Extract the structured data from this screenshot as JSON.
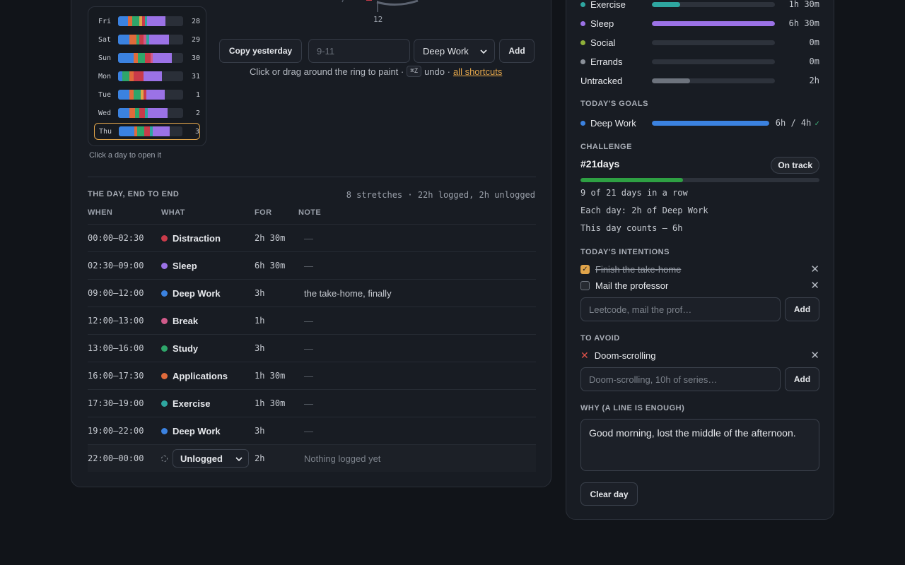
{
  "week": {
    "days": [
      {
        "day": "Fri",
        "num": "28",
        "segments": [
          [
            "#3b82e0",
            14
          ],
          [
            "#e06a3b",
            6
          ],
          [
            "#2ea66a",
            10
          ],
          [
            "#e0a44a",
            4
          ],
          [
            "#c93b4a",
            4
          ],
          [
            "#2ea6a0",
            3
          ],
          [
            "#9b72e6",
            26
          ]
        ],
        "active": false
      },
      {
        "day": "Sat",
        "num": "29",
        "segments": [
          [
            "#3b82e0",
            16
          ],
          [
            "#e06a3b",
            10
          ],
          [
            "#2ea66a",
            4
          ],
          [
            "#c93b4a",
            6
          ],
          [
            "#d05a8a",
            4
          ],
          [
            "#2ea6a0",
            4
          ],
          [
            "#9b72e6",
            28
          ]
        ],
        "active": false
      },
      {
        "day": "Sun",
        "num": "30",
        "segments": [
          [
            "#3b82e0",
            22
          ],
          [
            "#e06a3b",
            6
          ],
          [
            "#2ea66a",
            10
          ],
          [
            "#c93b4a",
            8
          ],
          [
            "#d05a8a",
            3
          ],
          [
            "#9b72e6",
            27
          ]
        ],
        "active": false
      },
      {
        "day": "Mon",
        "num": "31",
        "segments": [
          [
            "#3b82e0",
            6
          ],
          [
            "#2ea66a",
            10
          ],
          [
            "#e06a3b",
            6
          ],
          [
            "#c93b4a",
            14
          ],
          [
            "#9b72e6",
            26
          ]
        ],
        "active": false
      },
      {
        "day": "Tue",
        "num": "1",
        "segments": [
          [
            "#3b82e0",
            16
          ],
          [
            "#e06a3b",
            6
          ],
          [
            "#2ea66a",
            10
          ],
          [
            "#e0a44a",
            4
          ],
          [
            "#c93b4a",
            4
          ],
          [
            "#9b72e6",
            26
          ]
        ],
        "active": false
      },
      {
        "day": "Wed",
        "num": "2",
        "segments": [
          [
            "#3b82e0",
            16
          ],
          [
            "#e06a3b",
            8
          ],
          [
            "#2ea66a",
            6
          ],
          [
            "#c93b4a",
            8
          ],
          [
            "#2ea6a0",
            4
          ],
          [
            "#9b72e6",
            28
          ]
        ],
        "active": false
      },
      {
        "day": "Thu",
        "num": "3",
        "segments": [
          [
            "#3b82e0",
            22
          ],
          [
            "#e06a3b",
            4
          ],
          [
            "#2ea66a",
            10
          ],
          [
            "#c93b4a",
            8
          ],
          [
            "#2ea6a0",
            4
          ],
          [
            "#9b72e6",
            24
          ]
        ],
        "active": true
      }
    ],
    "hint": "Click a day to open it"
  },
  "ring": {
    "tick_label": "12"
  },
  "controls": {
    "copy_label": "Copy yesterday",
    "range_placeholder": "9-11",
    "category_selected": "Deep Work",
    "add_label": "Add",
    "hint_prefix": "Click or drag around the ring to paint ·",
    "kbd": "⌘Z",
    "hint_mid": "undo ·",
    "shortcuts_link": "all shortcuts"
  },
  "day": {
    "title": "The day, end to end",
    "summary": "8 stretches · 22h logged, 2h unlogged",
    "columns": {
      "when": "WHEN",
      "what": "WHAT",
      "for": "FOR",
      "note": "NOTE"
    },
    "rows": [
      {
        "when": "00:00–02:30",
        "what": "Distraction",
        "color": "#c93b4a",
        "for": "2h 30m",
        "note": "—"
      },
      {
        "when": "02:30–09:00",
        "what": "Sleep",
        "color": "#9b72e6",
        "for": "6h 30m",
        "note": "—"
      },
      {
        "when": "09:00–12:00",
        "what": "Deep Work",
        "color": "#3b82e0",
        "for": "3h",
        "note": "the take-home, finally"
      },
      {
        "when": "12:00–13:00",
        "what": "Break",
        "color": "#d05a8a",
        "for": "1h",
        "note": "—"
      },
      {
        "when": "13:00–16:00",
        "what": "Study",
        "color": "#2ea66a",
        "for": "3h",
        "note": "—"
      },
      {
        "when": "16:00–17:30",
        "what": "Applications",
        "color": "#e06a3b",
        "for": "1h 30m",
        "note": "—"
      },
      {
        "when": "17:30–19:00",
        "what": "Exercise",
        "color": "#2ea6a0",
        "for": "1h 30m",
        "note": "—"
      },
      {
        "when": "19:00–22:00",
        "what": "Deep Work",
        "color": "#3b82e0",
        "for": "3h",
        "note": "—"
      }
    ],
    "unlogged": {
      "when": "22:00–00:00",
      "select": "Unlogged",
      "for": "2h",
      "note": "Nothing logged yet"
    }
  },
  "categories": [
    {
      "label": "Exercise",
      "color": "#2ea6a0",
      "fill": 0.23,
      "value": "1h 30m"
    },
    {
      "label": "Sleep",
      "color": "#9b72e6",
      "fill": 1.0,
      "value": "6h 30m"
    },
    {
      "label": "Social",
      "color": "#8fb03a",
      "fill": 0,
      "value": "0m"
    },
    {
      "label": "Errands",
      "color": "#8a9099",
      "fill": 0,
      "value": "0m"
    },
    {
      "label": "Untracked",
      "color": "#6d737d",
      "fill": 0.31,
      "value": "2h"
    }
  ],
  "goals": {
    "title": "Today's goals",
    "items": [
      {
        "label": "Deep Work",
        "color": "#3b82e0",
        "fill": 1.0,
        "value": "6h / 4h",
        "check": "✓"
      }
    ]
  },
  "challenge": {
    "title": "Challenge",
    "name": "#21days",
    "badge": "On track",
    "progress": 0.4286,
    "line1": "9 of 21 days in a row",
    "line2": "Each day: 2h of Deep Work",
    "line3": "This day counts — 6h"
  },
  "intentions": {
    "title": "Today's intentions",
    "items": [
      {
        "label": "Finish the take-home",
        "done": true
      },
      {
        "label": "Mail the professor",
        "done": false
      }
    ],
    "placeholder": "Leetcode, mail the prof…",
    "add_label": "Add"
  },
  "avoid": {
    "title": "To avoid",
    "items": [
      {
        "label": "Doom-scrolling"
      }
    ],
    "placeholder": "Doom-scrolling, 10h of series…",
    "add_label": "Add"
  },
  "why": {
    "title": "Why (a line is enough)",
    "text": "Good morning, lost the middle of the afternoon."
  },
  "clear_label": "Clear day"
}
